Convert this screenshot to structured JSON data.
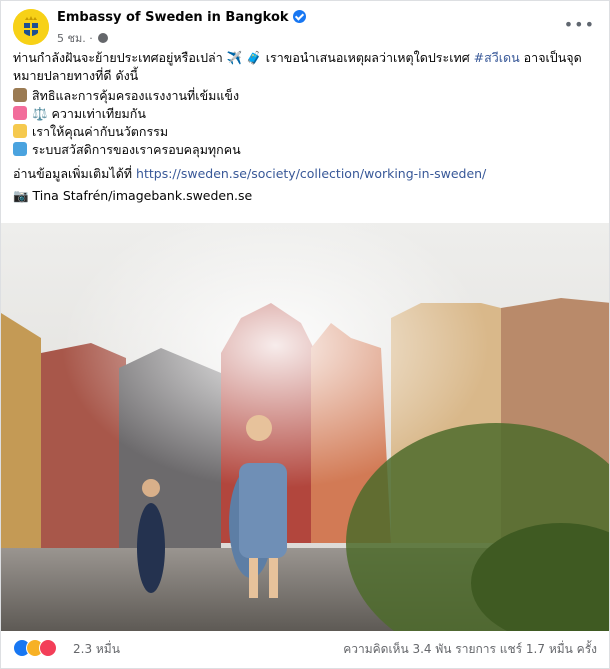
{
  "post": {
    "page_name": "Embassy of Sweden in Bangkok",
    "time": "5 ชม.",
    "separator": "·",
    "more_label": "•••",
    "intro_text": "ท่านกำลังฝันจะย้ายประเทศอยู่หรือเปล่า ✈️ 🧳 เราขอนำเสนอเหตุผลว่าเหตุใดประเทศ ",
    "hashtag": "#สวีเดน",
    "intro_text_2": " อาจเป็นจุดหมายปลายทางที่ดี ดังนี้",
    "bullets": [
      {
        "icon": "worker-icon",
        "color": "#9b7b53",
        "text": "สิทธิและการคุ้มครองแรงงานที่เข้มแข็ง"
      },
      {
        "icon": "equality-icon",
        "color": "#f26d9b",
        "text": "⚖️ ความเท่าเทียมกัน"
      },
      {
        "icon": "lightbulb-icon",
        "color": "#f5c94e",
        "text": "เราให้คุณค่ากับนวัตกรรม"
      },
      {
        "icon": "ship-icon",
        "color": "#4aa3df",
        "text": "ระบบสวัสดิการของเราครอบคลุมทุกคน"
      }
    ],
    "read_more_label": "อ่านข้อมูลเพิ่มเติมได้ที่ ",
    "read_more_url": "https://sweden.se/society/collection/working-in-sweden/",
    "photo_credit": "📷 Tina Stafrén/imagebank.sweden.se"
  },
  "footer": {
    "reaction_count": "2.3 หมื่น",
    "stats": "ความคิดเห็น 3.4 พัน รายการ  แชร์ 1.7 หมื่น ครั้ง"
  }
}
